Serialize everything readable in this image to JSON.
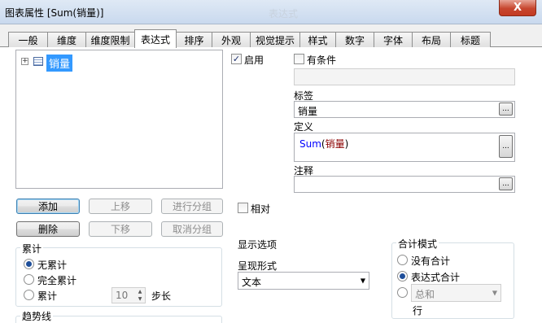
{
  "window": {
    "title": "图表属性 [Sum(销量)]",
    "close_glyph": "X",
    "ghost_title": "表达式"
  },
  "tabs": [
    "一般",
    "维度",
    "维度限制",
    "表达式",
    "排序",
    "外观",
    "视觉提示",
    "样式",
    "数字",
    "字体",
    "布局",
    "标题"
  ],
  "active_tab": "表达式",
  "tree": {
    "expander": "+",
    "item_label": "销量"
  },
  "buttons": {
    "add": "添加",
    "move_up": "上移",
    "group": "进行分组",
    "delete": "删除",
    "move_down": "下移",
    "ungroup": "取消分组"
  },
  "options": {
    "enable_label": "启用",
    "enable_checked": true,
    "conditional_label": "有条件",
    "conditional_checked": false,
    "relative_label": "相对",
    "relative_checked": false
  },
  "fields": {
    "label_caption": "标签",
    "label_value": "销量",
    "definition_caption": "定义",
    "definition_func": "Sum",
    "definition_arg": "销量",
    "comment_caption": "注释",
    "comment_value": "",
    "dots": "..."
  },
  "accumulate": {
    "title": "累计",
    "none": "无累计",
    "full": "完全累计",
    "partial": "累计",
    "steps_value": "10",
    "steps_label": "步长",
    "selected": "无累计"
  },
  "display": {
    "title": "显示选项",
    "representation_caption": "呈现形式",
    "representation_value": "文本"
  },
  "total_mode": {
    "title": "合计模式",
    "no_total": "没有合计",
    "expression_total": "表达式合计",
    "sum_value": "总和",
    "rows_label": "行",
    "selected": "表达式合计"
  },
  "trendline": {
    "title": "趋势线"
  },
  "colors": {
    "selection": "#3399ff",
    "definition_func": "#0000ff",
    "definition_arg": "#8b0000"
  }
}
